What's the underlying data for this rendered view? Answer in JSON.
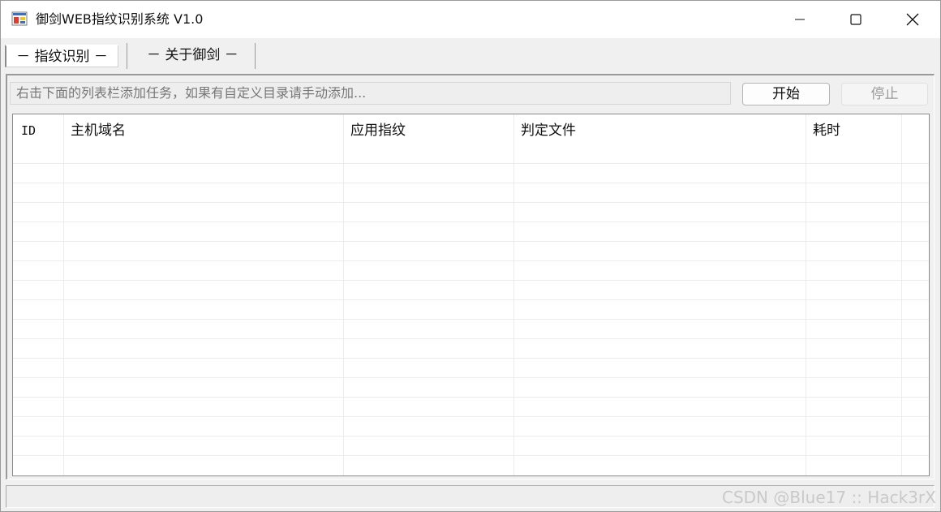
{
  "window": {
    "title": "御剑WEB指纹识别系统 V1.0",
    "app_icon": "app-window-icon",
    "controls": {
      "minimize": "minimize-icon",
      "maximize": "maximize-icon",
      "close": "close-icon"
    }
  },
  "tabs": [
    {
      "label": "－ 指纹识别 －",
      "active": true
    },
    {
      "label": "－ 关于御剑 －",
      "active": false
    }
  ],
  "toolbar": {
    "input_placeholder": "右击下面的列表栏添加任务，如果有自定义目录请手动添加...",
    "start_label": "开始",
    "stop_label": "停止"
  },
  "table": {
    "columns": [
      "ID",
      "主机域名",
      "应用指纹",
      "判定文件",
      "耗时"
    ],
    "rows": []
  },
  "watermark": "CSDN @Blue17 :: Hack3rX"
}
